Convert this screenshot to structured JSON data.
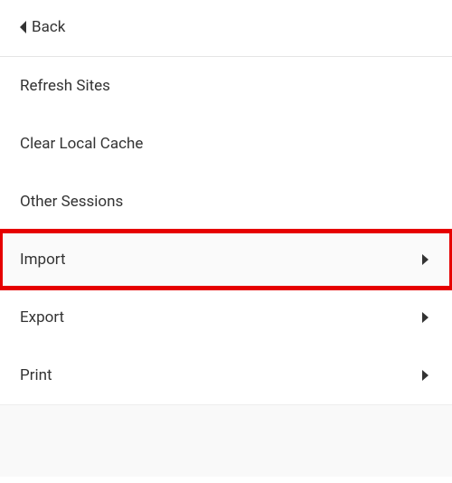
{
  "header": {
    "back_label": "Back"
  },
  "menu": {
    "items": [
      {
        "label": "Refresh Sites",
        "has_submenu": false
      },
      {
        "label": "Clear Local Cache",
        "has_submenu": false
      },
      {
        "label": "Other Sessions",
        "has_submenu": false
      },
      {
        "label": "Import",
        "has_submenu": true,
        "highlighted": true
      },
      {
        "label": "Export",
        "has_submenu": true
      },
      {
        "label": "Print",
        "has_submenu": true
      }
    ]
  }
}
